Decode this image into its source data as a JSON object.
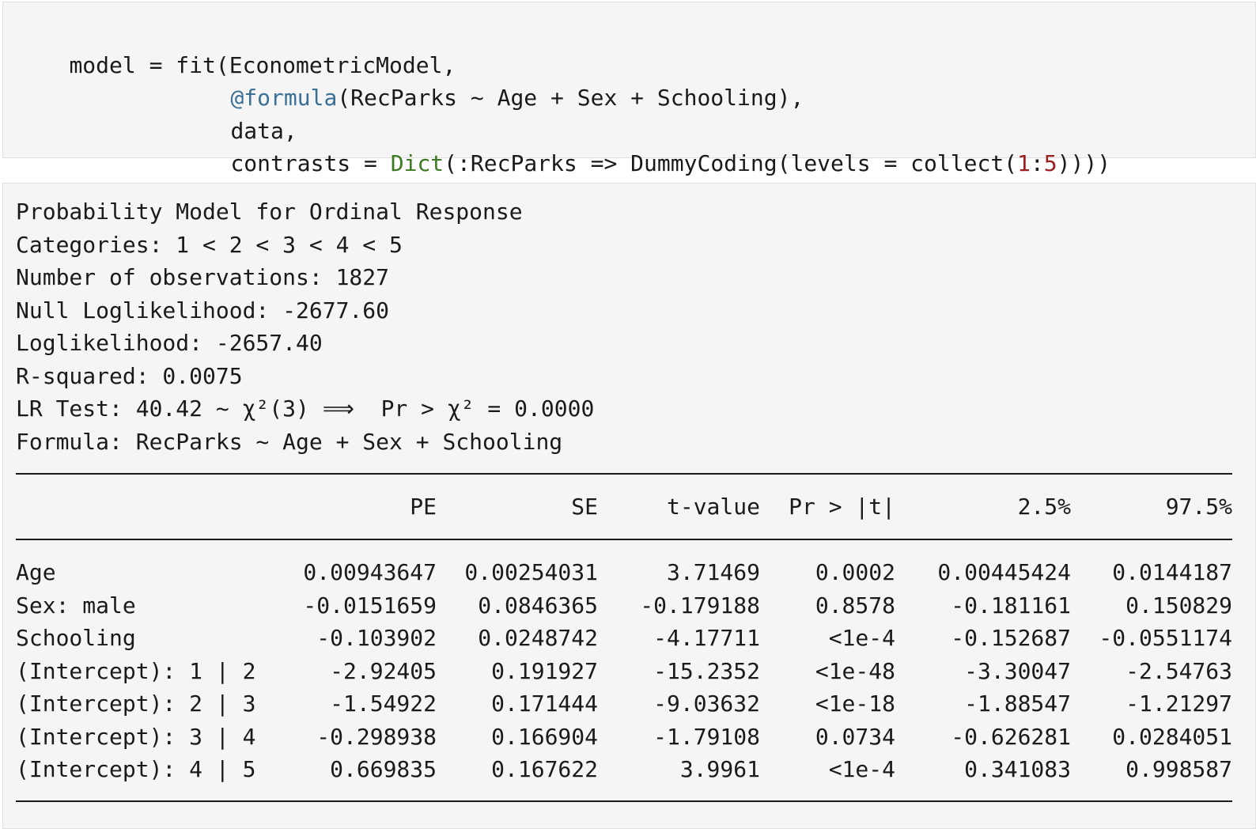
{
  "code": {
    "line1": "model = fit(EconometricModel,",
    "line2_macro": "@formula",
    "line2_rest": "(RecParks ~ Age + Sex + Schooling),",
    "line3": "data,",
    "line4_pre": "contrasts = ",
    "line4_func": "Dict",
    "line4_mid": "(:RecParks => DummyCoding(levels = collect(",
    "line4_num1": "1",
    "line4_colon": ":",
    "line4_num2": "5",
    "line4_end": "))))"
  },
  "output": {
    "header": [
      "Probability Model for Ordinal Response",
      "Categories: 1 < 2 < 3 < 4 < 5",
      "Number of observations: 1827",
      "Null Loglikelihood: -2677.60",
      "Loglikelihood: -2657.40",
      "R-squared: 0.0075",
      "LR Test: 40.42 ~ χ²(3) ⟹  Pr > χ² = 0.0000",
      "Formula: RecParks ~ Age + Sex + Schooling"
    ],
    "table": {
      "columns": [
        "PE",
        "SE",
        "t-value",
        "Pr > |t|",
        "2.5%",
        "97.5%"
      ],
      "rows": [
        {
          "name": "Age",
          "pe": "0.00943647",
          "se": "0.00254031",
          "t": "3.71469",
          "p": "0.0002",
          "lo": "0.00445424",
          "hi": "0.0144187"
        },
        {
          "name": "Sex: male",
          "pe": "-0.0151659",
          "se": "0.0846365",
          "t": "-0.179188",
          "p": "0.8578",
          "lo": "-0.181161",
          "hi": "0.150829"
        },
        {
          "name": "Schooling",
          "pe": "-0.103902",
          "se": "0.0248742",
          "t": "-4.17711",
          "p": "<1e-4",
          "lo": "-0.152687",
          "hi": "-0.0551174"
        },
        {
          "name": "(Intercept): 1 | 2",
          "pe": "-2.92405",
          "se": "0.191927",
          "t": "-15.2352",
          "p": "<1e-48",
          "lo": "-3.30047",
          "hi": "-2.54763"
        },
        {
          "name": "(Intercept): 2 | 3",
          "pe": "-1.54922",
          "se": "0.171444",
          "t": "-9.03632",
          "p": "<1e-18",
          "lo": "-1.88547",
          "hi": "-1.21297"
        },
        {
          "name": "(Intercept): 3 | 4",
          "pe": "-0.298938",
          "se": "0.166904",
          "t": "-1.79108",
          "p": "0.0734",
          "lo": "-0.626281",
          "hi": "0.0284051"
        },
        {
          "name": "(Intercept): 4 | 5",
          "pe": "0.669835",
          "se": "0.167622",
          "t": "3.9961",
          "p": "<1e-4",
          "lo": "0.341083",
          "hi": "0.998587"
        }
      ]
    }
  }
}
